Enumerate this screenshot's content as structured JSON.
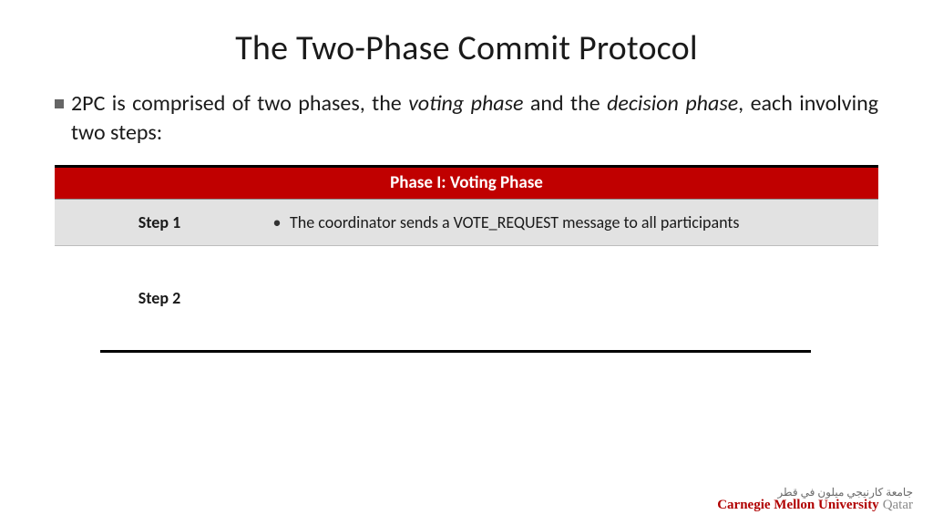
{
  "title": "The Two-Phase Commit Protocol",
  "intro": {
    "prefix": "2PC is comprised of two phases, the ",
    "emph1": "voting phase",
    "mid": " and the ",
    "emph2": "decision phase",
    "suffix": ", each involving two steps:"
  },
  "phase": {
    "header": "Phase I: Voting Phase"
  },
  "steps": {
    "s1_label": "Step 1",
    "s1_text": "The coordinator sends a VOTE_REQUEST message to all participants",
    "s2_label": "Step 2"
  },
  "footer": {
    "arabic": "جامعة كارنيجي ميلون في قطر",
    "brand": "Carnegie Mellon University",
    "campus": "Qatar"
  }
}
